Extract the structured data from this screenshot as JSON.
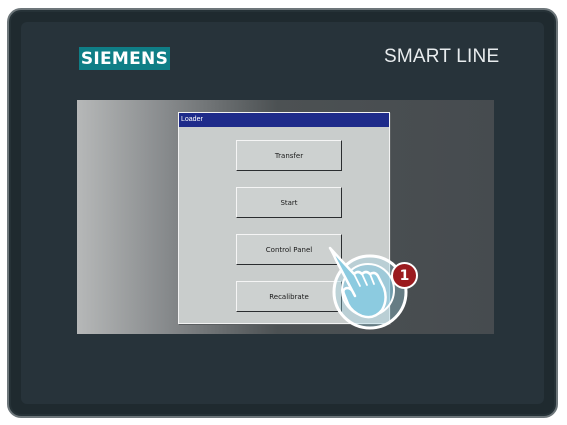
{
  "device": {
    "brand": "SIEMENS",
    "product_line": "SMART LINE",
    "bezel_color": "#1f2a2f",
    "brand_color": "#0f7e86"
  },
  "dialog": {
    "title": "Loader",
    "title_bar_color": "#1e2b8a",
    "buttons": [
      {
        "label": "Transfer"
      },
      {
        "label": "Start"
      },
      {
        "label": "Control Panel"
      },
      {
        "label": "Recalibrate"
      }
    ]
  },
  "callout": {
    "step_number": "1",
    "icon": "tap-hand-icon",
    "target": "Control Panel",
    "color": "#9b1b1f"
  }
}
